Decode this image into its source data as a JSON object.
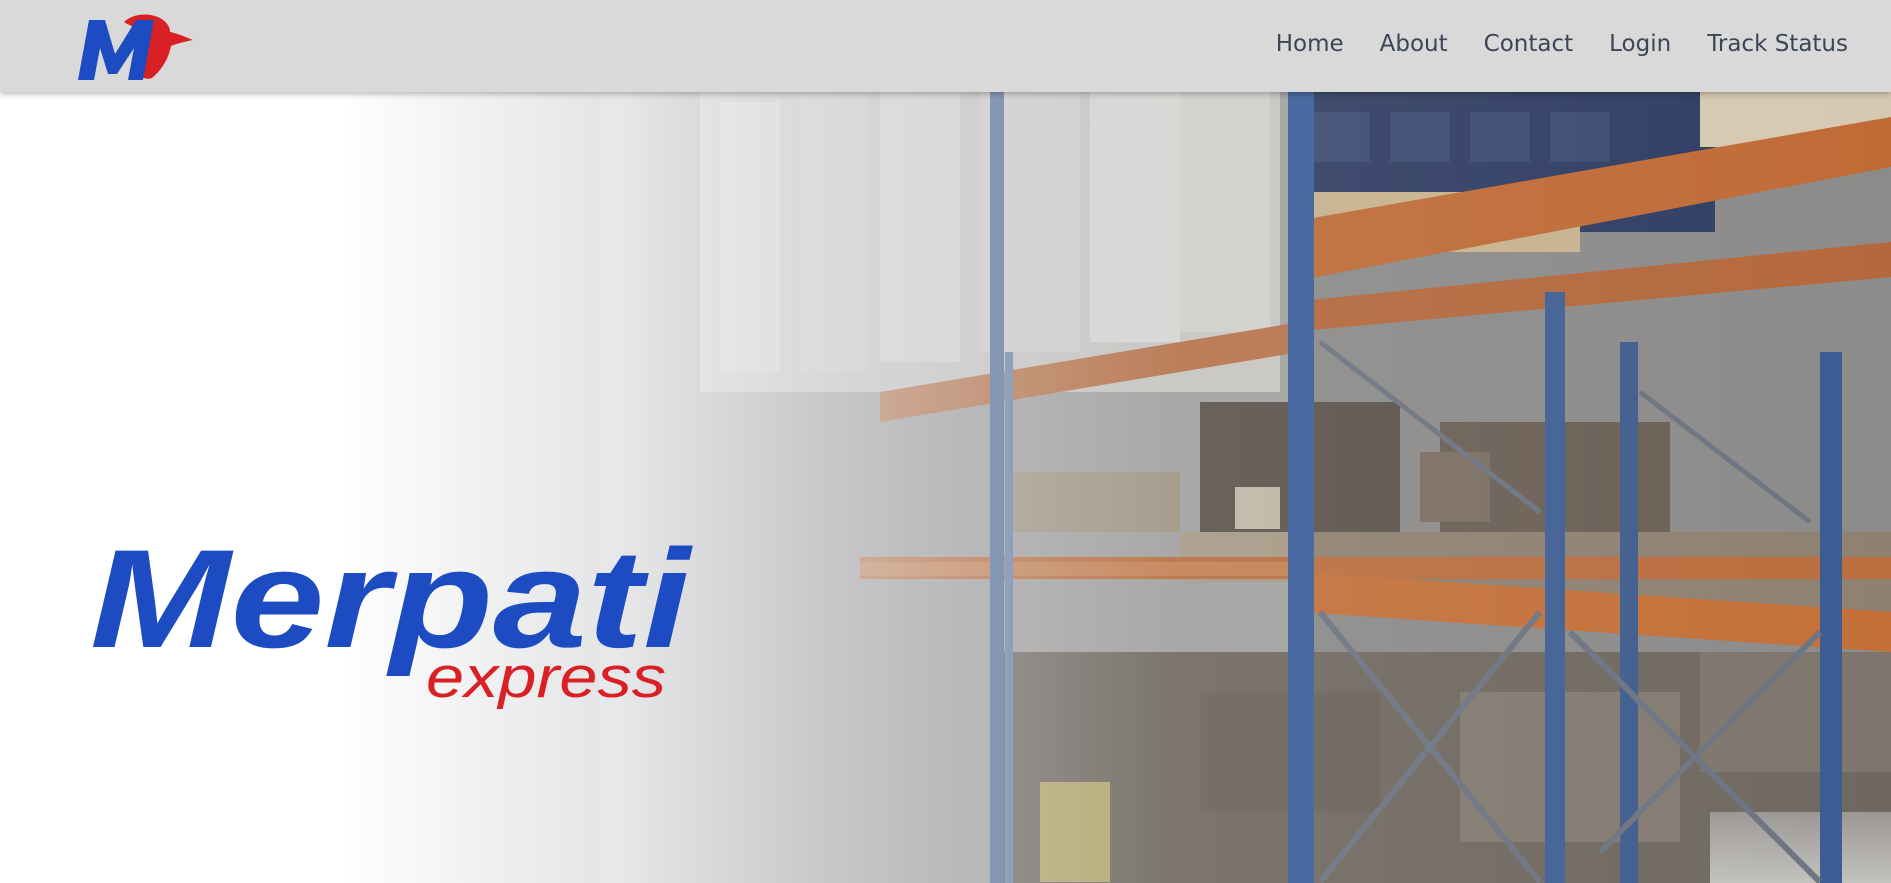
{
  "header": {
    "logo": {
      "icon": "merpati-bird-m-logo",
      "letter": "M"
    },
    "nav": [
      {
        "label": "Home"
      },
      {
        "label": "About"
      },
      {
        "label": "Contact"
      },
      {
        "label": "Login"
      },
      {
        "label": "Track Status"
      }
    ]
  },
  "hero": {
    "brand_primary": "Merpati",
    "brand_secondary": "express",
    "background": "warehouse-shelves-photo"
  },
  "colors": {
    "navbar_bg": "#d9d9d9",
    "nav_text": "#3b4556",
    "brand_blue": "#1d4bc2",
    "brand_red": "#d92025",
    "shelf_orange": "#c8703a",
    "upright_blue": "#3a5f9b"
  }
}
